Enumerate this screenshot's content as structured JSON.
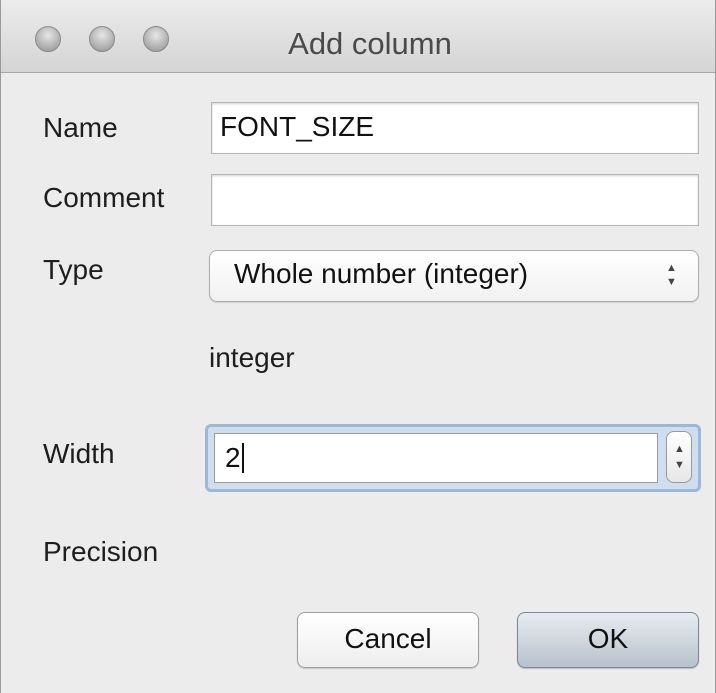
{
  "window": {
    "title": "Add column"
  },
  "fields": {
    "name_label": "Name",
    "name_value": "FONT_SIZE",
    "comment_label": "Comment",
    "comment_value": "",
    "type_label": "Type",
    "type_selected": "Whole number (integer)",
    "type_name": "integer",
    "width_label": "Width",
    "width_value": "2",
    "precision_label": "Precision"
  },
  "buttons": {
    "cancel": "Cancel",
    "ok": "OK"
  },
  "icons": {
    "close": "close-traffic-light",
    "minimize": "minimize-traffic-light",
    "zoom": "zoom-traffic-light"
  }
}
